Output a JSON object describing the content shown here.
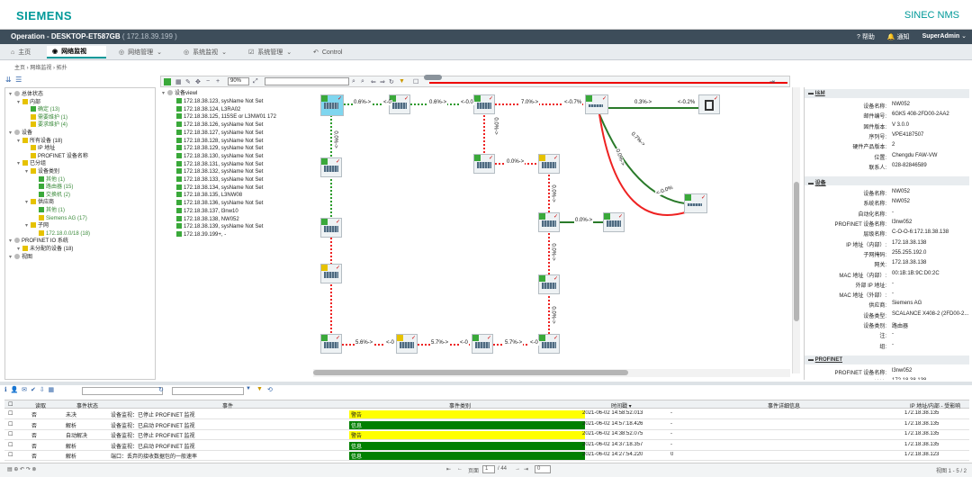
{
  "brand": {
    "logo": "SIEMENS",
    "product": "SINEC NMS"
  },
  "titlebar": {
    "title": "Operation - DESKTOP-ET587GB",
    "ip": "( 172.18.39.199 )",
    "help": "帮助",
    "notify": "通知",
    "user": "SuperAdmin"
  },
  "tabs": [
    "主页",
    "网络监视",
    "网络管理",
    "系统监视",
    "系统管理",
    "Control"
  ],
  "breadcrumb": "主页  ›  网络监视  ›  拓扑",
  "tree": [
    {
      "t": "总体状态",
      "l": 0
    },
    {
      "t": "内部",
      "l": 1
    },
    {
      "t": "确定 (13)",
      "l": 2
    },
    {
      "t": "需要维护 (1)",
      "l": 2
    },
    {
      "t": "要求维护 (4)",
      "l": 2
    },
    {
      "t": "设备",
      "l": 0
    },
    {
      "t": "所有设备 (18)",
      "l": 1
    },
    {
      "t": "IP 地址",
      "l": 2
    },
    {
      "t": "PROFINET 设备名称",
      "l": 2
    },
    {
      "t": "已分组",
      "l": 1
    },
    {
      "t": "设备类别",
      "l": 2
    },
    {
      "t": "其他 (1)",
      "l": 3
    },
    {
      "t": "路由器 (15)",
      "l": 3
    },
    {
      "t": "交换机 (2)",
      "l": 3
    },
    {
      "t": "供应商",
      "l": 2
    },
    {
      "t": "其他 (1)",
      "l": 3
    },
    {
      "t": "Siemens AG (17)",
      "l": 3
    },
    {
      "t": "子网",
      "l": 2
    },
    {
      "t": "172.18.0.0/18 (18)",
      "l": 3
    },
    {
      "t": "PROFINET IO 系统",
      "l": 0
    },
    {
      "t": "未分配的设备 (18)",
      "l": 1
    },
    {
      "t": "视图",
      "l": 0
    }
  ],
  "devlist_title": "设备viewl",
  "devices": [
    "172.18.38.123, sysName Not Set",
    "172.18.38.124, L3RA02",
    "172.18.38.125, 115SE or L3NW01 172",
    "172.18.38.126, sysName Not Set",
    "172.18.38.127, sysName Not Set",
    "172.18.38.128, sysName Not Set",
    "172.18.38.129, sysName Not Set",
    "172.18.38.130, sysName Not Set",
    "172.18.38.131, sysName Not Set",
    "172.18.38.132, sysName Not Set",
    "172.18.38.133, sysName Not Set",
    "172.18.38.134, sysName Not Set",
    "172.18.38.135, L3NW08",
    "172.18.38.136, sysName Not Set",
    "172.18.38.137, l3nw10",
    "172.18.38.138, NW052",
    "172.18.38.139, sysName Not Set",
    "172.18.39.199+, -"
  ],
  "zoom": "90%",
  "links": [
    "0.6%->",
    "<-0",
    "0.6%->",
    "<-0.0",
    "7.0%->",
    "<-0.7%",
    "0.3%->",
    "<-0.2%",
    "0.7%->",
    "0.0%->",
    "0.0%->",
    "0.0%->",
    "0.0%->",
    "0.0%->",
    "0.0%->",
    "0.0%->",
    "5.6%->",
    "<-0",
    "5.7%->",
    "<-0",
    "5.7%->",
    "<-0",
    "<-0.0%",
    "0.0%->"
  ],
  "props": {
    "sec1": "I&M",
    "im": [
      [
        "设备名称:",
        "NW052"
      ],
      [
        "邮件编号:",
        "6GK5 408-2FD00-2AA2"
      ],
      [
        "固件版本:",
        "V 3.0.0"
      ],
      [
        "序列号:",
        "VPE4187507"
      ],
      [
        "硬件产品版本:",
        "2"
      ],
      [
        "位置:",
        "Chengdu FAW-VW"
      ],
      [
        "联系人:",
        "028-82846589"
      ]
    ],
    "sec2": "设备",
    "dev": [
      [
        "设备名称:",
        "NW052"
      ],
      [
        "系统名称:",
        "NW052"
      ],
      [
        "自动化名称:",
        "-"
      ],
      [
        "PROFINET 设备名称:",
        "l3nw052"
      ],
      [
        "层级名称:",
        "C-O-O-6:172.18.38.138"
      ],
      [
        "IP 地址（内部）:",
        "172.18.38.138"
      ],
      [
        "子网掩码:",
        "255.255.192.0"
      ],
      [
        "网关:",
        "172.18.38.138"
      ],
      [
        "MAC 地址（内部）:",
        "00:1B:1B:9C:D0:2C"
      ],
      [
        "外部 IP 地址:",
        "-"
      ],
      [
        "MAC 地址（外部）:",
        "-"
      ],
      [
        "供应商:",
        "Siemens AG"
      ],
      [
        "设备类型:",
        "SCALANCE X408-2 (2FD00-2..."
      ],
      [
        "设备类别:",
        "路由器"
      ],
      [
        "注:",
        "-"
      ],
      [
        "组:",
        "-"
      ]
    ],
    "sec3": "PROFINET",
    "pn": [
      [
        "PROFINET 设备名称:",
        "l3nw052"
      ],
      [
        "IP 地址:",
        "172.18.38.138"
      ]
    ]
  },
  "events": {
    "headers": [
      "读取",
      "事件状态",
      "事件",
      "事件类别",
      "时间戳",
      "事件详细信息",
      "IP 地址/内部 - 受影响"
    ],
    "rows": [
      {
        "read": "否",
        "state": "未决",
        "event": "设备监视：已停止 PROFINET 监视",
        "cat": "警告",
        "catc": "y",
        "time": "2021-06-02 14:58:52.013",
        "detail": "-",
        "ip": "172.18.38.135"
      },
      {
        "read": "否",
        "state": "解析",
        "event": "设备监视：已启动 PROFINET 监视",
        "cat": "信息",
        "catc": "g",
        "time": "2021-06-02 14:57:18.426",
        "detail": "-",
        "ip": "172.18.38.135"
      },
      {
        "read": "否",
        "state": "自动解决",
        "event": "设备监视：已停止 PROFINET 监视",
        "cat": "警告",
        "catc": "y",
        "time": "2021-06-02 14:38:52.075",
        "detail": "-",
        "ip": "172.18.38.135"
      },
      {
        "read": "否",
        "state": "解析",
        "event": "设备监视：已启动 PROFINET 监视",
        "cat": "信息",
        "catc": "g",
        "time": "2021-06-02 14:37:18.357",
        "detail": "-",
        "ip": "172.18.38.135"
      },
      {
        "read": "否",
        "state": "解析",
        "event": "端口：丢弃的接收数据包的一般速率",
        "cat": "信息",
        "catc": "g",
        "time": "2021-06-02 14:27:54.220",
        "detail": "0",
        "ip": "172.18.38.123"
      }
    ]
  },
  "footer": {
    "page_label": "页面",
    "page": "1",
    "of": "/ 44",
    "per": "0",
    "view": "视图 1 - 5 / 2"
  }
}
